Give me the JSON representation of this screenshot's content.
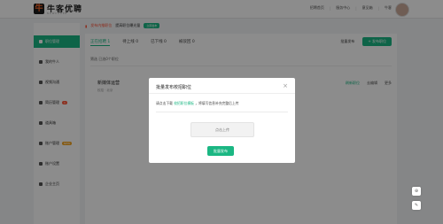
{
  "topbar": {
    "logo_mark": "牛",
    "logo_name": "牛客优聘",
    "logo_sub": "NOWCODER",
    "nav": [
      "招聘首页",
      "服务中心",
      "意见箱",
      "牛客"
    ]
  },
  "sidebar": {
    "items": [
      {
        "label": "职位管理",
        "active": true
      },
      {
        "label": "我的牛人"
      },
      {
        "label": "视频沟通"
      },
      {
        "label": "简历管理",
        "badge": "1"
      },
      {
        "label": "道具箱"
      },
      {
        "label": "账户管理",
        "tag": "NEW"
      },
      {
        "label": "账户设置"
      },
      {
        "label": "企业主页"
      }
    ]
  },
  "banner": {
    "warn": "发布内推职位",
    "text": "提高职位曝光量",
    "pill": "立即发布"
  },
  "tabs": [
    "正在招聘 1",
    "待上线 0",
    "已下线 0",
    "被驳回 0"
  ],
  "actions": {
    "bulk": "批量发布",
    "publish": "+ 发布职位"
  },
  "filter": "筛选  已选0个职位",
  "job": {
    "title": "新媒体运营",
    "meta": "校招 · 北京",
    "ops": [
      "刷新职位",
      "去编辑",
      "更多"
    ]
  },
  "modal": {
    "title": "批量发布校招职位",
    "close": "×",
    "desc_pre": "请点击下载",
    "desc_link": "校招职位模板",
    "desc_post": "，将填写信息补充完整后上传",
    "upload": "点击上传",
    "submit": "批量发布"
  },
  "float": [
    "⊕",
    "✎"
  ]
}
